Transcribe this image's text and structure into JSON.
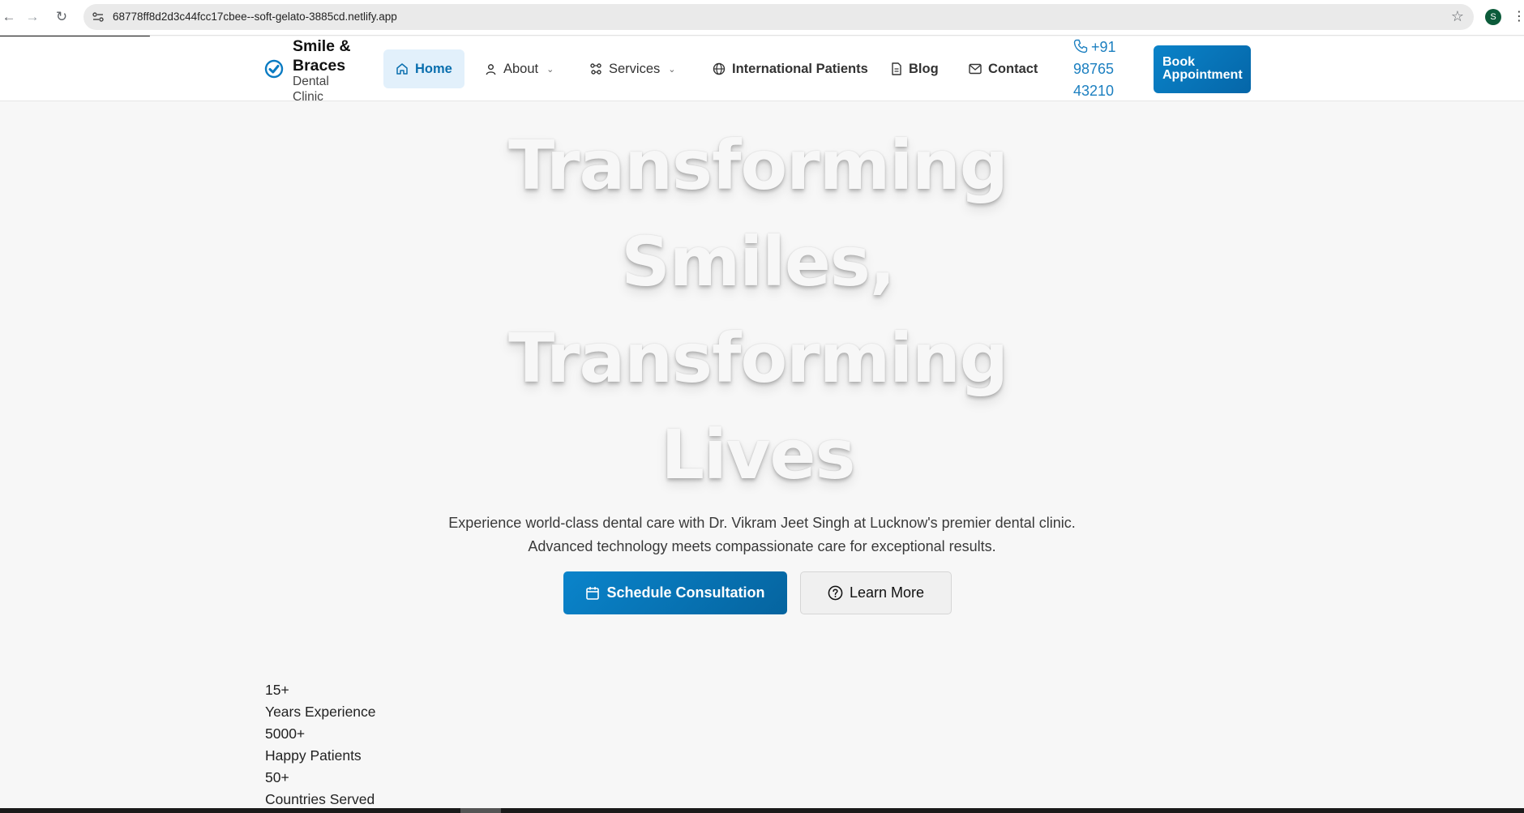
{
  "browser": {
    "url": "68778ff8d2d3c44fcc17cbee--soft-gelato-3885cd.netlify.app",
    "profile_initial": "S"
  },
  "header": {
    "logo_title": "Smile & Braces",
    "logo_subtitle": "Dental Clinic",
    "nav": {
      "home": "Home",
      "about": "About",
      "services": "Services",
      "international": "International Patients",
      "blog": "Blog",
      "contact": "Contact"
    },
    "phone": "+91 98765 43210",
    "book_button": "Book Appointment"
  },
  "hero": {
    "title": "Transforming Smiles, Transforming Lives",
    "subtitle_line1": "Experience world-class dental care with Dr. Vikram Jeet Singh at Lucknow's premier dental clinic.",
    "subtitle_line2": "Advanced technology meets compassionate care for exceptional results.",
    "primary_button": "Schedule Consultation",
    "secondary_button": "Learn More"
  },
  "stats": [
    {
      "value": "15+",
      "label": "Years Experience"
    },
    {
      "value": "5000+",
      "label": "Happy Patients"
    },
    {
      "value": "50+",
      "label": "Countries Served"
    }
  ],
  "colors": {
    "brand_blue": "#0a83c9",
    "nav_active_bg": "#e2f0fb",
    "phone_blue": "#1b7fc0"
  }
}
